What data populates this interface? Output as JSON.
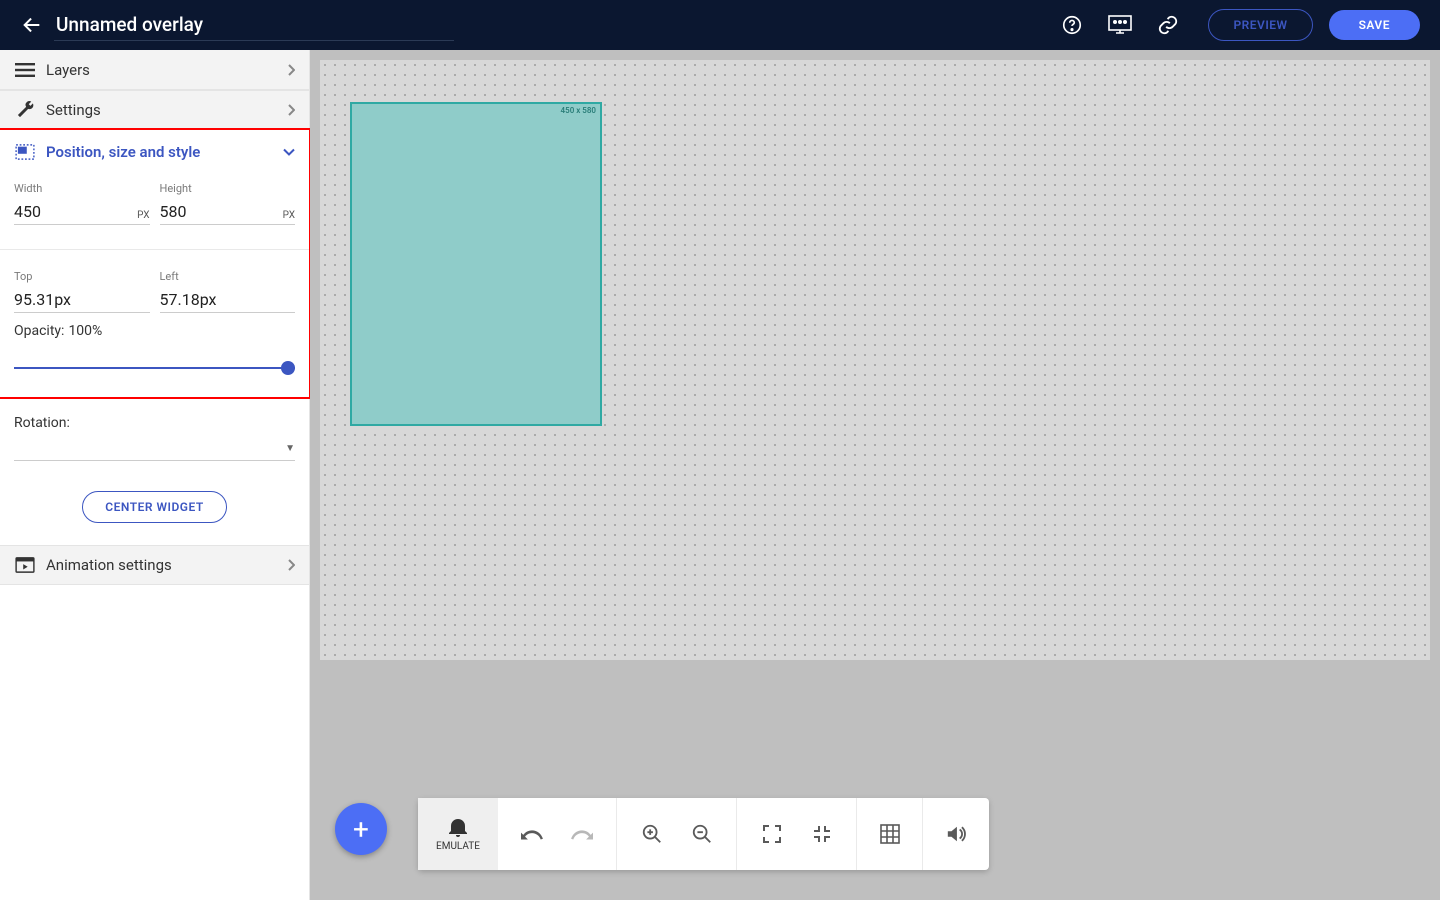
{
  "header": {
    "title": "Unnamed overlay",
    "preview_label": "PREVIEW",
    "save_label": "SAVE"
  },
  "sidebar": {
    "layers_label": "Layers",
    "settings_label": "Settings",
    "position_label": "Position, size and style",
    "animation_label": "Animation settings",
    "width_label": "Width",
    "height_label": "Height",
    "top_label": "Top",
    "left_label": "Left",
    "unit_px": "PX",
    "width_value": "450",
    "height_value": "580",
    "top_value": "95.31px",
    "left_value": "57.18px",
    "opacity_prefix": "Opacity: ",
    "opacity_value": "100%",
    "rotation_label": "Rotation:",
    "center_widget_label": "CENTER WIDGET"
  },
  "canvas": {
    "widget_size_tag": "450 x 580"
  },
  "toolbar": {
    "emulate_label": "EMULATE"
  }
}
